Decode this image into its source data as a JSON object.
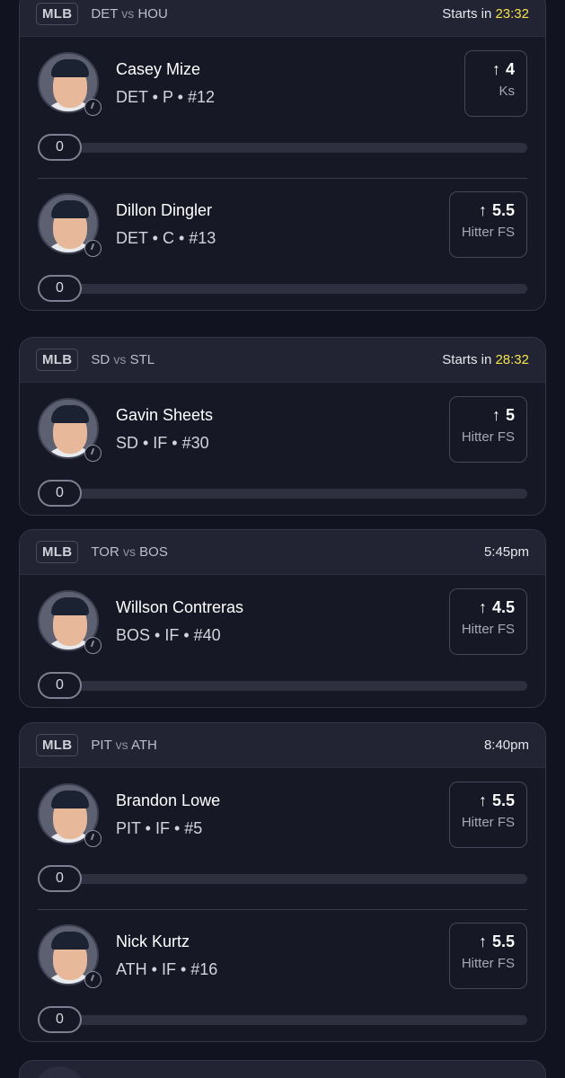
{
  "games": [
    {
      "league": "MLB",
      "team_a": "DET",
      "vs": "vs",
      "team_b": "HOU",
      "start_prefix": "Starts in ",
      "start_time": "23:32",
      "players": [
        {
          "name": "Casey Mize",
          "meta": "DET • P • #12",
          "line": "4",
          "stat": "Ks",
          "progress_value": "0",
          "progress_fraction": 0
        },
        {
          "name": "Dillon Dingler",
          "meta": "DET • C • #13",
          "line": "5.5",
          "stat": "Hitter FS",
          "progress_value": "0",
          "progress_fraction": 0
        }
      ]
    },
    {
      "league": "MLB",
      "team_a": "SD",
      "vs": "vs",
      "team_b": "STL",
      "start_prefix": "Starts in ",
      "start_time": "28:32",
      "players": [
        {
          "name": "Gavin Sheets",
          "meta": "SD • IF • #30",
          "line": "5",
          "stat": "Hitter FS",
          "progress_value": "0",
          "progress_fraction": 0
        }
      ]
    },
    {
      "league": "MLB",
      "team_a": "TOR",
      "vs": "vs",
      "team_b": "BOS",
      "start_prefix": "",
      "start_time": "5:45pm",
      "players": [
        {
          "name": "Willson Contreras",
          "meta": "BOS • IF • #40",
          "line": "4.5",
          "stat": "Hitter FS",
          "progress_value": "0",
          "progress_fraction": 0
        }
      ]
    },
    {
      "league": "MLB",
      "team_a": "PIT",
      "vs": "vs",
      "team_b": "ATH",
      "start_prefix": "",
      "start_time": "8:40pm",
      "players": [
        {
          "name": "Brandon Lowe",
          "meta": "PIT • IF • #5",
          "line": "5.5",
          "stat": "Hitter FS",
          "progress_value": "0",
          "progress_fraction": 0
        },
        {
          "name": "Nick Kurtz",
          "meta": "ATH • IF • #16",
          "line": "5.5",
          "stat": "Hitter FS",
          "progress_value": "0",
          "progress_fraction": 0
        }
      ]
    }
  ],
  "icons": {
    "direction": "arrow-up-icon",
    "pending": "clock-icon"
  },
  "colors": {
    "background": "#121320",
    "card": "#161825",
    "countdown": "#f4e34d",
    "track": "#2e3040"
  }
}
